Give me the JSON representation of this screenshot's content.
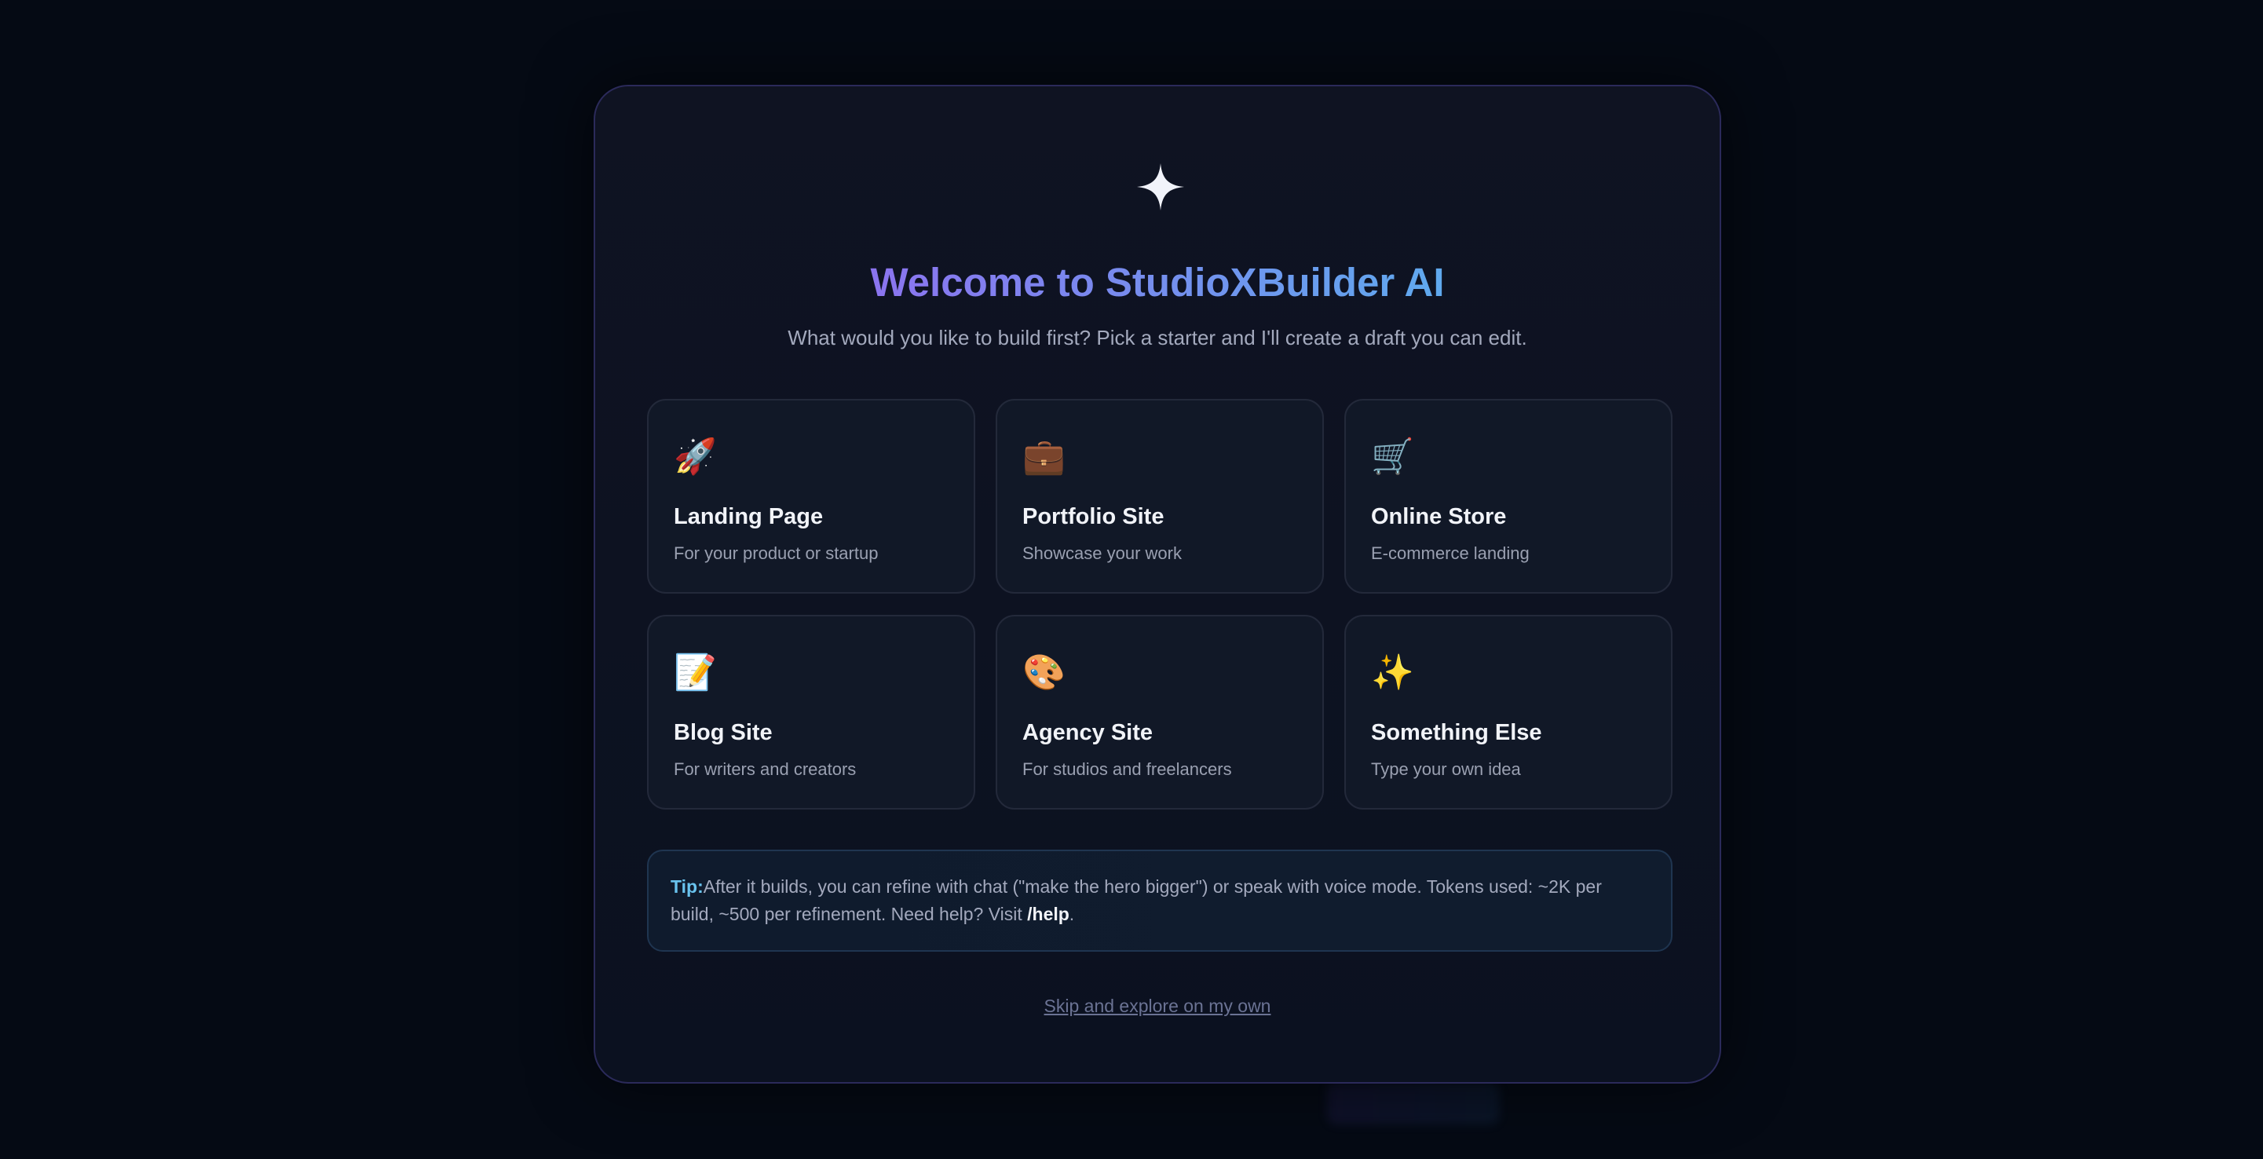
{
  "welcome": {
    "icon": "four-point-sparkle-icon",
    "title": "Welcome to StudioXBuilder AI",
    "subtitle": "What would you like to build first? Pick a starter and I'll create a draft you can edit.",
    "title_gradient": [
      "#8b74ef",
      "#5fa9ee"
    ]
  },
  "starters": [
    {
      "icon": "🚀",
      "icon_name": "rocket-icon",
      "title": "Landing Page",
      "desc": "For your product or startup"
    },
    {
      "icon": "💼",
      "icon_name": "briefcase-icon",
      "title": "Portfolio Site",
      "desc": "Showcase your work"
    },
    {
      "icon": "🛒",
      "icon_name": "shopping-cart-icon",
      "title": "Online Store",
      "desc": "E-commerce landing"
    },
    {
      "icon": "📝",
      "icon_name": "memo-icon",
      "title": "Blog Site",
      "desc": "For writers and creators"
    },
    {
      "icon": "🎨",
      "icon_name": "palette-icon",
      "title": "Agency Site",
      "desc": "For studios and freelancers"
    },
    {
      "icon": "✨",
      "icon_name": "sparkles-icon",
      "title": "Something Else",
      "desc": "Type your own idea"
    }
  ],
  "tip": {
    "label": "Tip:",
    "text": "After it builds, you can refine with chat (\"make the hero bigger\") or speak with voice mode. Tokens used: ~2K per build, ~500 per refinement. Need help? Visit ",
    "link": "/help",
    "suffix": "."
  },
  "skip_label": "Skip and explore on my own",
  "colors": {
    "background": "#050a14",
    "card_bg": "#111827",
    "tip_label": "#69c3ee",
    "muted_text": "#a3a9bd"
  }
}
